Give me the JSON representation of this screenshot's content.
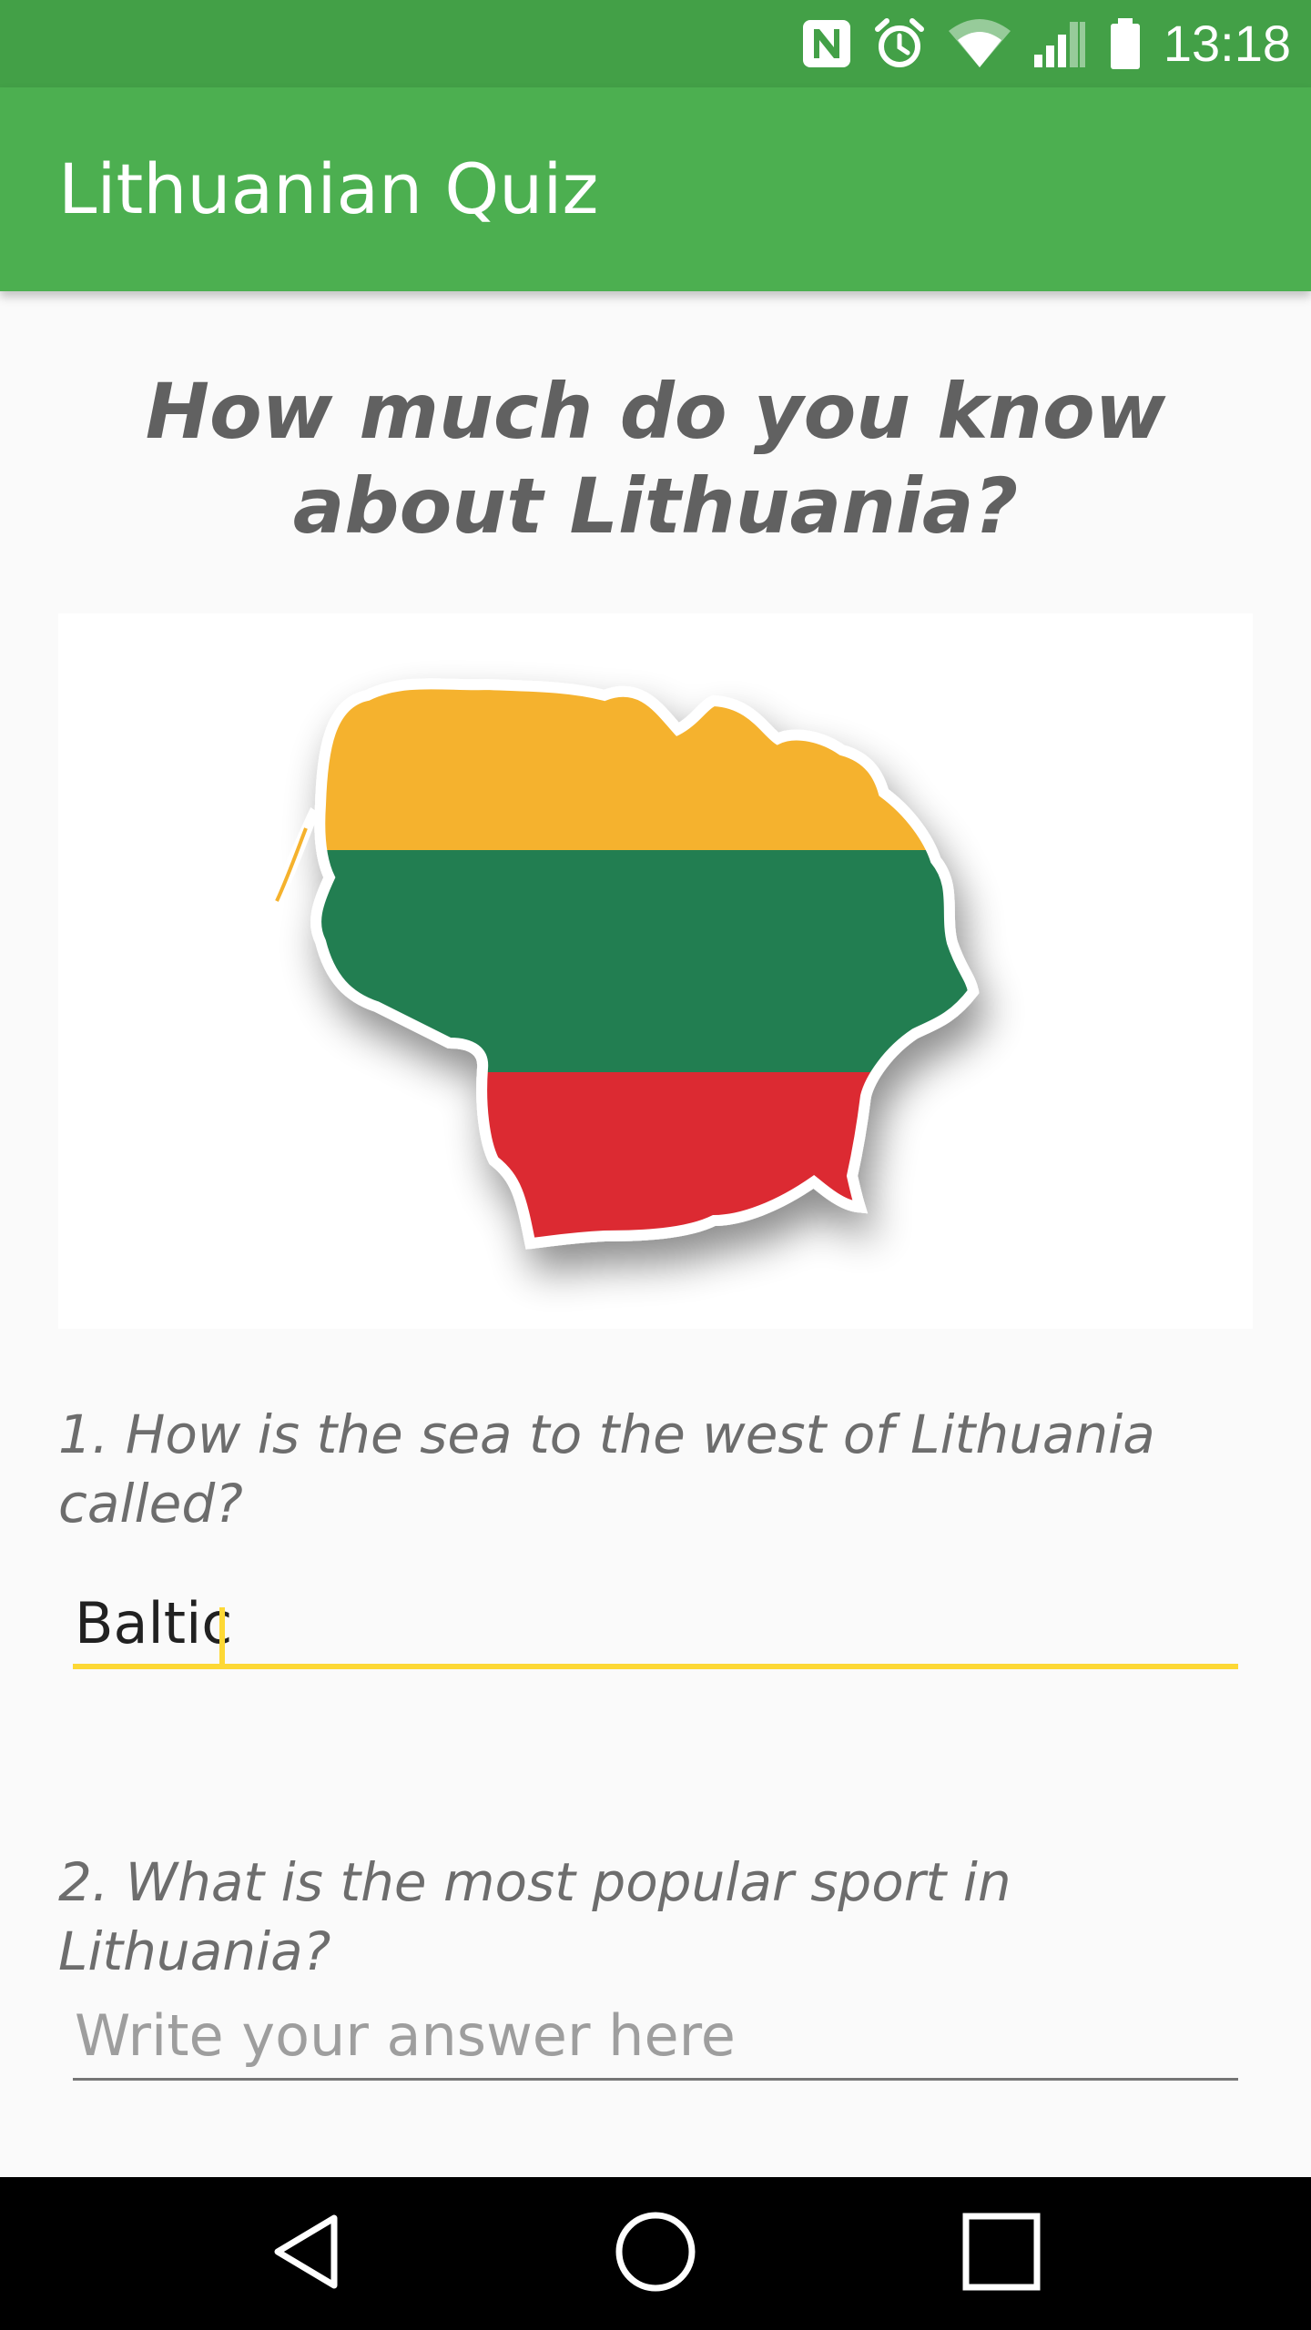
{
  "status_bar": {
    "time": "13:18",
    "icons": [
      "nfc-icon",
      "alarm-icon",
      "wifi-icon",
      "signal-icon",
      "battery-icon"
    ]
  },
  "app_bar": {
    "title": "Lithuanian Quiz"
  },
  "main": {
    "headline_line1": "How much do you know",
    "headline_line2": "about Lithuania?",
    "image": "lithuania-flag-map",
    "questions": [
      {
        "text": "1. How is the sea to the west of Lithuania called?",
        "answer_value": "Baltic",
        "answer_placeholder": ""
      },
      {
        "text": "2. What is the most popular sport in Lithuania?",
        "answer_value": "",
        "answer_placeholder": "Write your answer here"
      }
    ]
  },
  "nav_bar": {
    "icons": [
      "back-icon",
      "home-icon",
      "recents-icon"
    ]
  },
  "colors": {
    "status_bar": "#43a047",
    "app_bar": "#4caf50",
    "accent": "#fdd835",
    "flag_yellow": "#f5b22d",
    "flag_green": "#217e51",
    "flag_red": "#dc2a30"
  }
}
